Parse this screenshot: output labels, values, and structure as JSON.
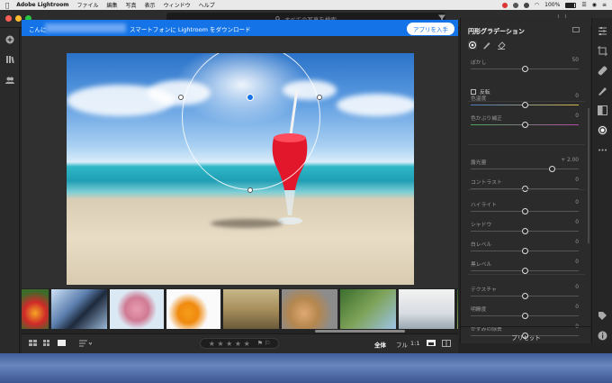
{
  "menubar": {
    "app_name": "Adobe Lightroom",
    "items": [
      "ファイル",
      "編集",
      "写真",
      "表示",
      "ウィンドウ",
      "ヘルプ"
    ],
    "battery": "100%"
  },
  "toolbar": {
    "search_placeholder": "すべての写真を検索"
  },
  "banner": {
    "text_prefix": "こんに",
    "text_suffix": "スマートフォンに Lightroom をダウンロード",
    "button_label": "アプリを入手",
    "close_label": "×"
  },
  "bottombar": {
    "stars": "★ ★ ★ ★ ★",
    "zoom_all": "全体",
    "zoom_full": "フル",
    "zoom_ratio": "1:1"
  },
  "panel": {
    "title": "円形グラデーション",
    "feather_label": "ぼかし",
    "feather_value": "50",
    "invert_label": "反転",
    "sliders": [
      {
        "label": "色温度",
        "value": "0",
        "pos": 0.5
      },
      {
        "label": "色かぶり補正",
        "value": "0",
        "pos": 0.5
      },
      {
        "label": "露光量",
        "value": "+ 2.00",
        "pos": 0.75
      },
      {
        "label": "コントラスト",
        "value": "0",
        "pos": 0.5
      },
      {
        "label": "ハイライト",
        "value": "0",
        "pos": 0.5
      },
      {
        "label": "シャドウ",
        "value": "0",
        "pos": 0.5
      },
      {
        "label": "白レベル",
        "value": "0",
        "pos": 0.5
      },
      {
        "label": "黒レベル",
        "value": "0",
        "pos": 0.5
      },
      {
        "label": "テクスチャ",
        "value": "0",
        "pos": 0.5
      },
      {
        "label": "明瞭度",
        "value": "0",
        "pos": 0.5
      },
      {
        "label": "かすみの除去",
        "value": "0",
        "pos": 0.5
      }
    ],
    "feather_pos": 0.5,
    "preset_label": "プリセット"
  },
  "colors": {
    "accent": "#1473e6",
    "panel_bg": "#2b2b2b"
  }
}
